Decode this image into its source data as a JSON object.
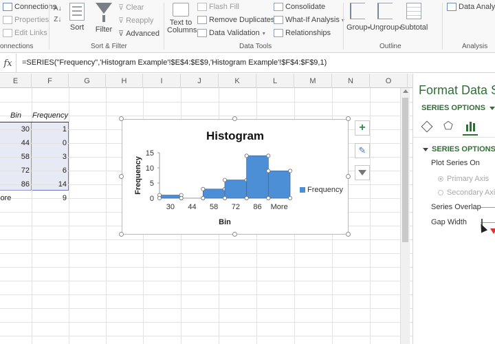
{
  "ribbon": {
    "connections_label": "Connections",
    "properties_label": "Properties",
    "edit_links_label": "Edit Links",
    "connections_group": "onnections",
    "sort_label": "Sort",
    "filter_label": "Filter",
    "clear_label": "Clear",
    "reapply_label": "Reapply",
    "advanced_label": "Advanced",
    "sort_filter_group": "Sort & Filter",
    "text_to_columns_line1": "Text to",
    "text_to_columns_line2": "Columns",
    "flash_fill_label": "Flash Fill",
    "remove_duplicates_label": "Remove Duplicates",
    "data_validation_label": "Data Validation",
    "consolidate_label": "Consolidate",
    "what_if_label": "What-If Analysis",
    "relationships_label": "Relationships",
    "data_tools_group": "Data Tools",
    "group_label": "Group",
    "ungroup_label": "Ungroup",
    "subtotal_label": "Subtotal",
    "outline_group": "Outline",
    "data_analysis_label": "Data Analysis",
    "analysis_group": "Analysis"
  },
  "formula_bar": {
    "fx_label": "fx",
    "formula": "=SERIES(\"Frequency\",'Histogram Example'!$E$4:$E$9,'Histogram Example'!$F$4:$F$9,1)"
  },
  "grid": {
    "columns": [
      "E",
      "F",
      "G",
      "H",
      "I",
      "J",
      "K",
      "L",
      "M",
      "N",
      "O"
    ],
    "headers": {
      "bin": "Bin",
      "frequency": "Frequency"
    },
    "rows": [
      {
        "bin": "30",
        "frequency": "1"
      },
      {
        "bin": "44",
        "frequency": "0"
      },
      {
        "bin": "58",
        "frequency": "3"
      },
      {
        "bin": "72",
        "frequency": "6"
      },
      {
        "bin": "86",
        "frequency": "14"
      },
      {
        "bin": "lore",
        "frequency": "9"
      }
    ]
  },
  "chart_data": {
    "type": "bar",
    "title": "Histogram",
    "xlabel": "Bin",
    "ylabel": "Frequency",
    "categories": [
      "30",
      "44",
      "58",
      "72",
      "86",
      "More"
    ],
    "series": [
      {
        "name": "Frequency",
        "values": [
          1,
          0,
          3,
          6,
          14,
          9
        ]
      }
    ],
    "ylim": [
      0,
      15
    ],
    "yticks": [
      "0",
      "5",
      "10",
      "15"
    ],
    "legend_position": "right",
    "bar_color": "#4d8fd6",
    "grid": false
  },
  "pane": {
    "title": "Format Data S",
    "series_options_dropdown": "SERIES OPTIONS",
    "section_title": "SERIES OPTIONS",
    "plot_series_on": "Plot Series On",
    "primary_axis": "Primary Axis",
    "secondary_axis": "Secondary Axis",
    "series_overlap": "Series Overlap",
    "gap_width": "Gap Width"
  }
}
